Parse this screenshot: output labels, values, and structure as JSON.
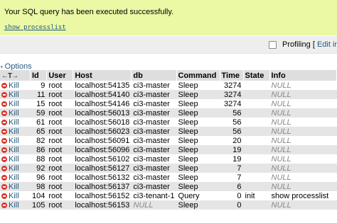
{
  "success_message": "Your SQL query has been executed successfully.",
  "sql_query": "show processlist",
  "profiling_label": "Profiling",
  "edit_inline_label": "Edit inlin",
  "options_label": "Options",
  "columns": [
    "Id",
    "User",
    "Host",
    "db",
    "Command",
    "Time",
    "State",
    "Info"
  ],
  "kill_label": "Kill",
  "rows": [
    {
      "id": "9",
      "user": "root",
      "host": "localhost:54135",
      "db": "ci3-master",
      "command": "Sleep",
      "time": "3274",
      "state": "",
      "info": "NULL"
    },
    {
      "id": "11",
      "user": "root",
      "host": "localhost:54140",
      "db": "ci3-master",
      "command": "Sleep",
      "time": "3274",
      "state": "",
      "info": "NULL"
    },
    {
      "id": "15",
      "user": "root",
      "host": "localhost:54146",
      "db": "ci3-master",
      "command": "Sleep",
      "time": "3274",
      "state": "",
      "info": "NULL"
    },
    {
      "id": "59",
      "user": "root",
      "host": "localhost:56013",
      "db": "ci3-master",
      "command": "Sleep",
      "time": "56",
      "state": "",
      "info": "NULL"
    },
    {
      "id": "61",
      "user": "root",
      "host": "localhost:56018",
      "db": "ci3-master",
      "command": "Sleep",
      "time": "56",
      "state": "",
      "info": "NULL"
    },
    {
      "id": "65",
      "user": "root",
      "host": "localhost:56023",
      "db": "ci3-master",
      "command": "Sleep",
      "time": "56",
      "state": "",
      "info": "NULL"
    },
    {
      "id": "82",
      "user": "root",
      "host": "localhost:56091",
      "db": "ci3-master",
      "command": "Sleep",
      "time": "20",
      "state": "",
      "info": "NULL"
    },
    {
      "id": "86",
      "user": "root",
      "host": "localhost:56096",
      "db": "ci3-master",
      "command": "Sleep",
      "time": "19",
      "state": "",
      "info": "NULL"
    },
    {
      "id": "88",
      "user": "root",
      "host": "localhost:56102",
      "db": "ci3-master",
      "command": "Sleep",
      "time": "19",
      "state": "",
      "info": "NULL"
    },
    {
      "id": "92",
      "user": "root",
      "host": "localhost:56127",
      "db": "ci3-master",
      "command": "Sleep",
      "time": "7",
      "state": "",
      "info": "NULL"
    },
    {
      "id": "96",
      "user": "root",
      "host": "localhost:56132",
      "db": "ci3-master",
      "command": "Sleep",
      "time": "7",
      "state": "",
      "info": "NULL"
    },
    {
      "id": "98",
      "user": "root",
      "host": "localhost:56137",
      "db": "ci3-master",
      "command": "Sleep",
      "time": "6",
      "state": "",
      "info": "NULL"
    },
    {
      "id": "104",
      "user": "root",
      "host": "localhost:56152",
      "db": "ci3-tenant-1",
      "command": "Query",
      "time": "0",
      "state": "init",
      "info": "show processlist"
    },
    {
      "id": "105",
      "user": "root",
      "host": "localhost:56153",
      "db": "NULL",
      "command": "Sleep",
      "time": "0",
      "state": "",
      "info": "NULL"
    }
  ]
}
